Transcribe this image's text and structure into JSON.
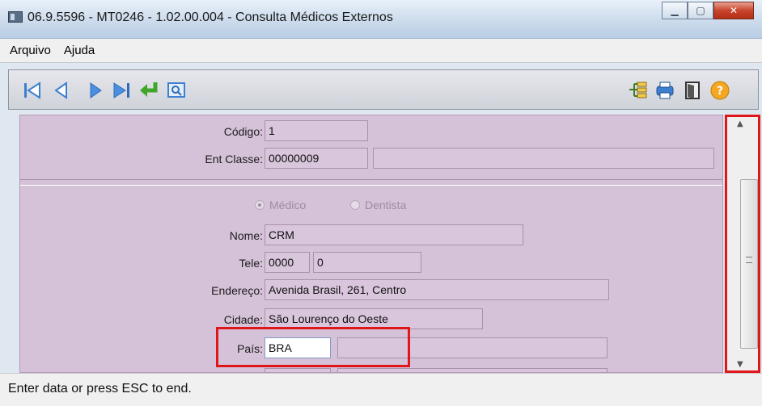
{
  "window": {
    "title": "06.9.5596 - MT0246 - 1.02.00.004 - Consulta Médicos Externos"
  },
  "menu": {
    "items": [
      "Arquivo",
      "Ajuda"
    ]
  },
  "toolbar": {
    "left_icons": [
      "first-record-icon",
      "previous-record-icon",
      "next-record-icon",
      "last-record-icon",
      "goto-return-icon",
      "search-zoom-icon"
    ],
    "right_icons": [
      "relationship-tree-icon",
      "print-icon",
      "exit-door-icon",
      "help-icon"
    ]
  },
  "form": {
    "codigo_label": "Código:",
    "codigo_value": "1",
    "ent_classe_label": "Ent Classe:",
    "ent_classe_value": "00000009",
    "ent_classe_desc": "",
    "radio_medico": "Médico",
    "radio_dentista": "Dentista",
    "nome_label": "Nome:",
    "nome_value": "CRM",
    "tele_label": "Tele:",
    "tele_ddd": "0000",
    "tele_number": "0",
    "endereco_label": "Endereço:",
    "endereco_value": "Avenida Brasil, 261, Centro",
    "cidade_label": "Cidade:",
    "cidade_value": "São Lourenço do Oeste",
    "pais_label": "País:",
    "pais_value": "BRA",
    "pais_desc": ""
  },
  "status": {
    "message": "Enter data or press ESC to end."
  },
  "colors": {
    "form_background": "#d6c2d8",
    "highlight_border": "#e0161b"
  }
}
